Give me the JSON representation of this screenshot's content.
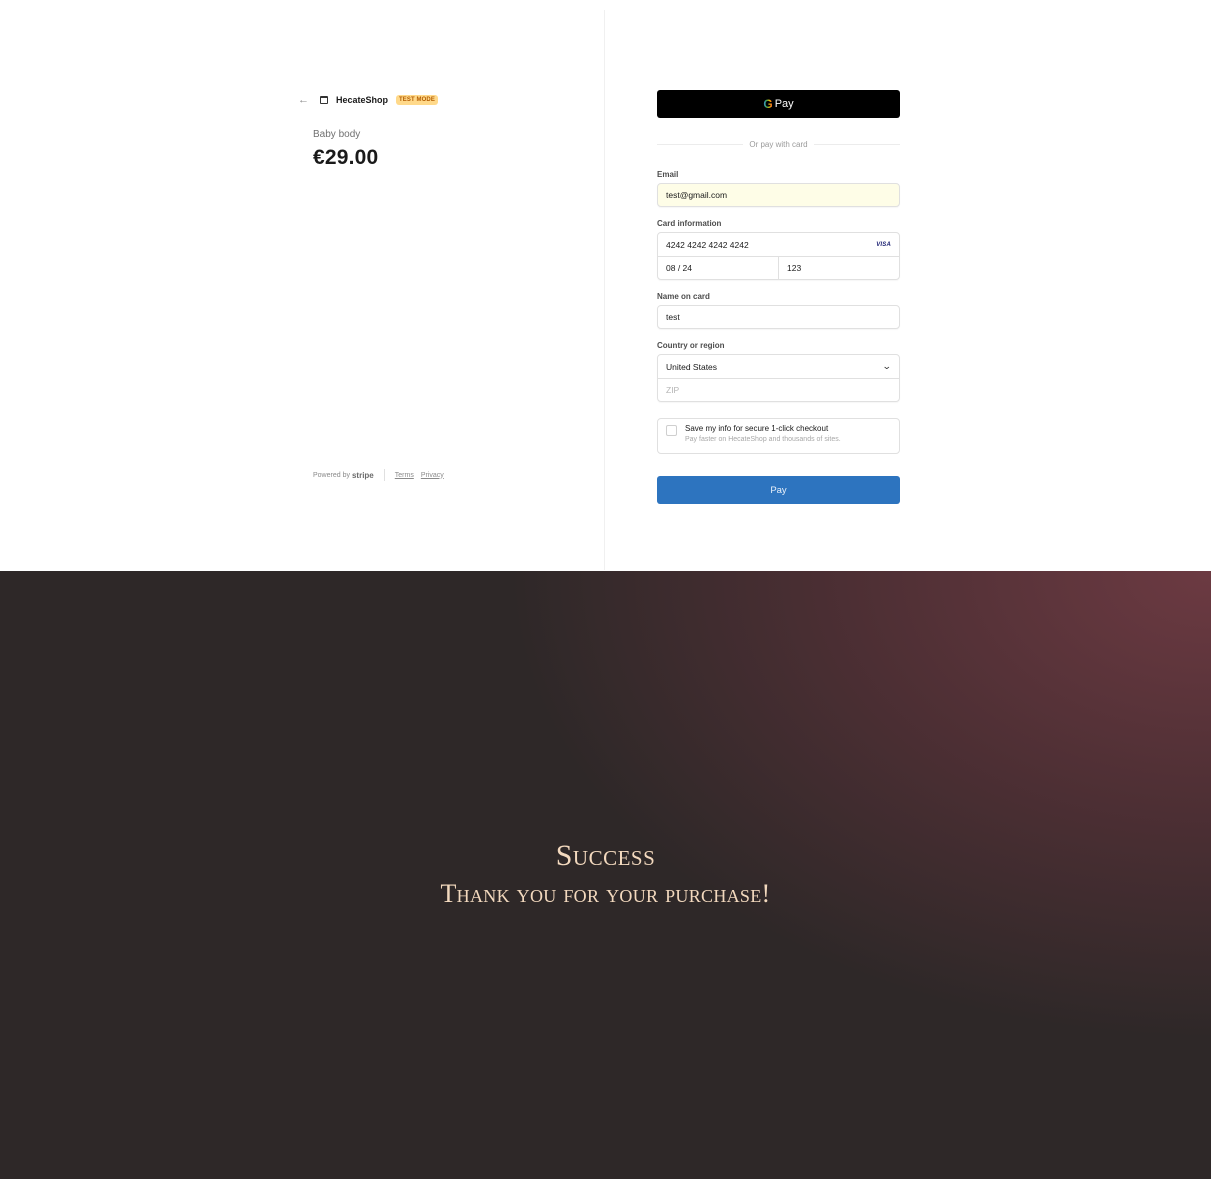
{
  "summary": {
    "back_icon": "arrow-left-icon",
    "store_icon": "store-icon",
    "store_name": "HecateShop",
    "badge": "TEST MODE",
    "product_name": "Baby body",
    "price": "€29.00"
  },
  "footer": {
    "powered_by": "Powered by",
    "stripe": "stripe",
    "terms": "Terms",
    "privacy": "Privacy"
  },
  "payment": {
    "gpay": {
      "g": "G",
      "label": "Pay"
    },
    "or_text": "Or pay with card",
    "email": {
      "label": "Email",
      "value": "test@gmail.com"
    },
    "card": {
      "label": "Card information",
      "number": "4242 4242 4242 4242",
      "brand": "VISA",
      "expiry": "08 / 24",
      "cvc": "123"
    },
    "name": {
      "label": "Name on card",
      "value": "test"
    },
    "country": {
      "label": "Country or region",
      "value": "United States",
      "zip_placeholder": "ZIP"
    },
    "save": {
      "title": "Save my info for secure 1-click checkout",
      "subtitle": "Pay faster on HecateShop and thousands of sites."
    },
    "pay_button": "Pay"
  },
  "success": {
    "title": "Success",
    "subtitle": "Thank you for your purchase!"
  },
  "colors": {
    "accent": "#2d74bf",
    "badge_bg": "#ffd98a",
    "success_text": "#f3d9be",
    "success_bg": "#2e2828"
  }
}
